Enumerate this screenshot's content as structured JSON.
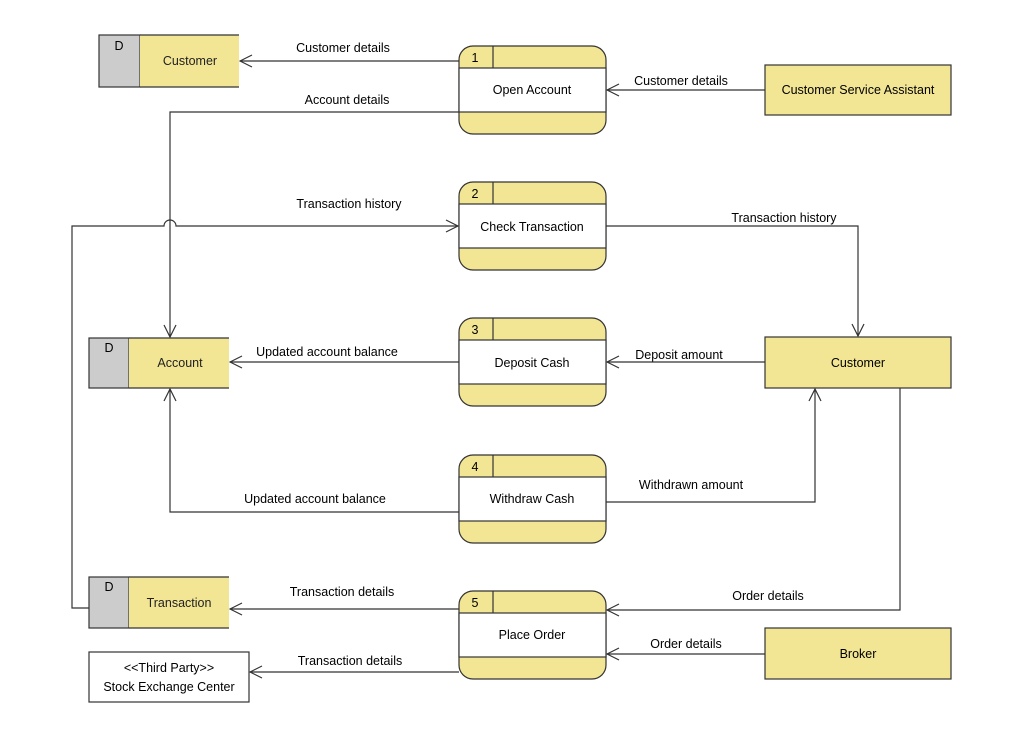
{
  "colors": {
    "fill": "#f2e694",
    "store_id_fill": "#cccccc",
    "line": "#333333"
  },
  "stores": {
    "customer": {
      "id": "D",
      "name": "Customer"
    },
    "account": {
      "id": "D",
      "name": "Account"
    },
    "transaction": {
      "id": "D",
      "name": "Transaction"
    }
  },
  "processes": [
    {
      "number": "1",
      "name": "Open Account"
    },
    {
      "number": "2",
      "name": "Check Transaction"
    },
    {
      "number": "3",
      "name": "Deposit Cash"
    },
    {
      "number": "4",
      "name": "Withdraw Cash"
    },
    {
      "number": "5",
      "name": "Place Order"
    }
  ],
  "entities": {
    "csa": "Customer Service Assistant",
    "customer": "Customer",
    "broker": "Broker",
    "third_party_stereotype": "<<Third Party>>",
    "third_party_name": "Stock Exchange Center"
  },
  "flows": {
    "customer_details_1": "Customer details",
    "customer_details_2": "Customer details",
    "account_details": "Account details",
    "transaction_history_1": "Transaction history",
    "transaction_history_2": "Transaction history",
    "updated_balance_1": "Updated account balance",
    "deposit_amount": "Deposit amount",
    "updated_balance_2": "Updated account balance",
    "withdrawn_amount": "Withdrawn amount",
    "transaction_details_1": "Transaction details",
    "order_details_1": "Order details",
    "order_details_2": "Order details",
    "transaction_details_2": "Transaction details"
  }
}
